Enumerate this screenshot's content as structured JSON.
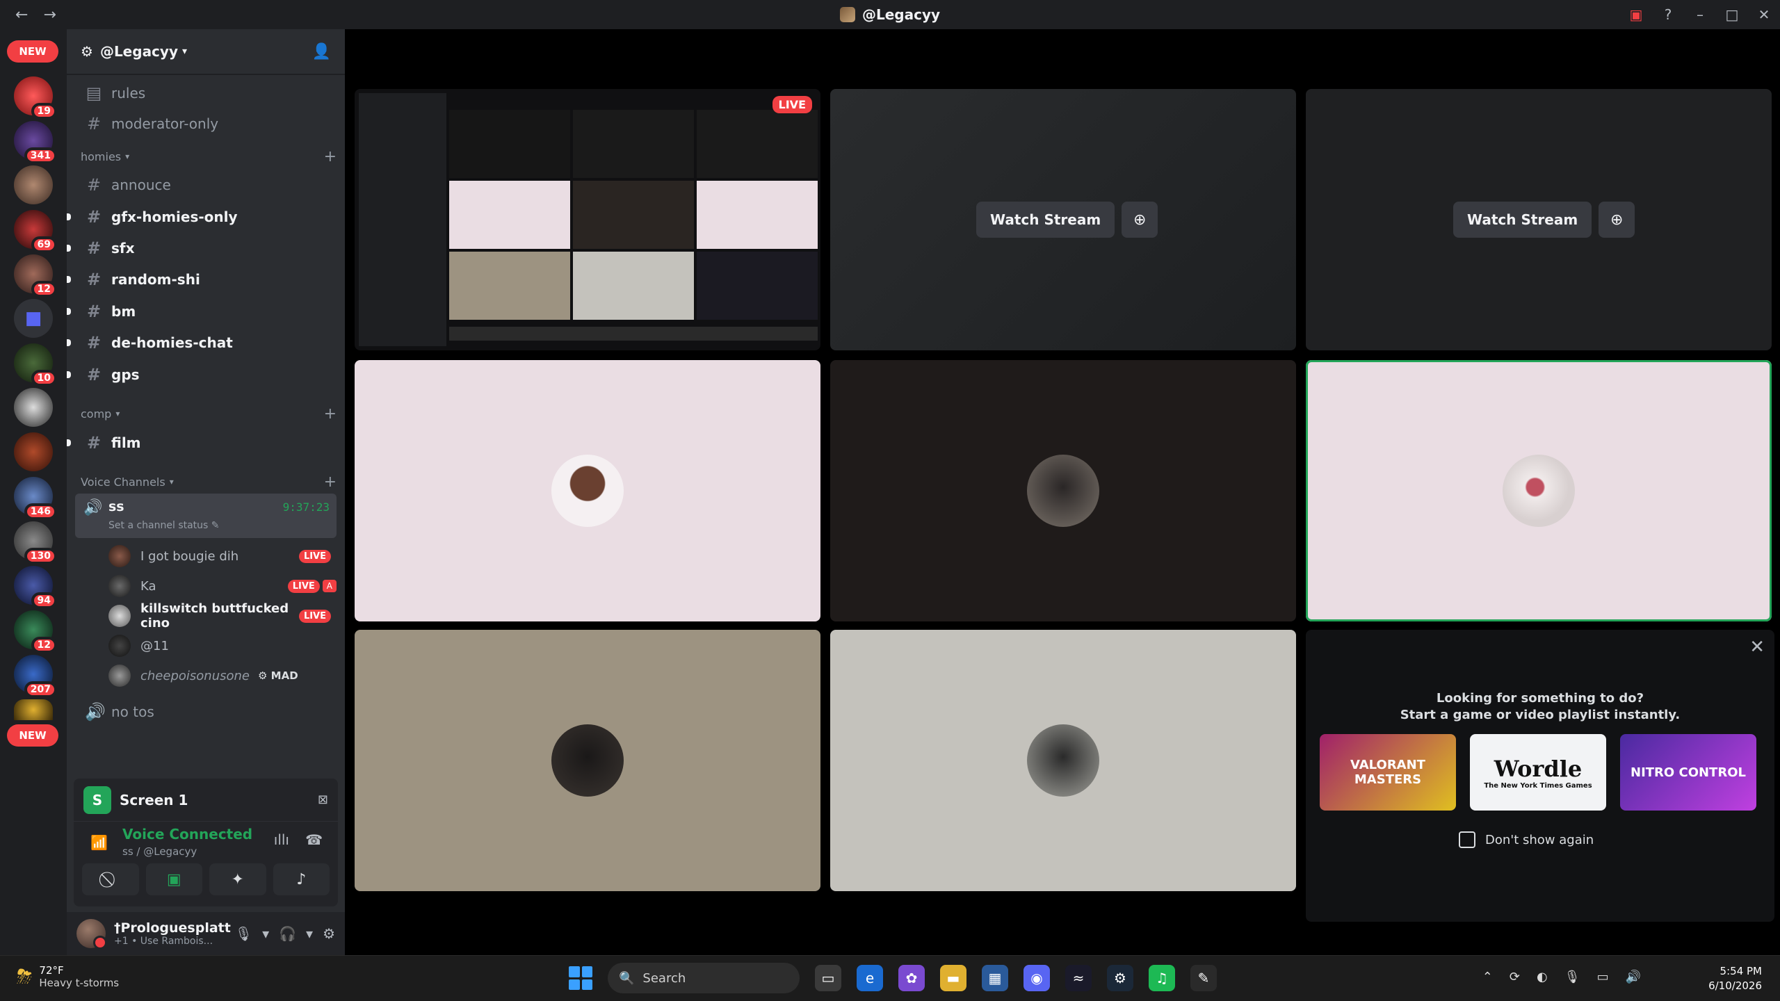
{
  "window": {
    "title": "@Legacyy"
  },
  "rail": {
    "new_top": "NEW",
    "new_bottom": "NEW",
    "badges": [
      "19",
      "341",
      "",
      "69",
      "12",
      "",
      "10",
      "",
      "",
      "146",
      "130",
      "94",
      "12",
      "207"
    ]
  },
  "server": {
    "name": "@Legacyy",
    "channels_top": [
      "rules",
      "moderator-only"
    ],
    "cat_homies": "homies",
    "homies_channels": [
      "annouce",
      "gfx-homies-only",
      "sfx",
      "random-shi",
      "bm",
      "de-homies-chat",
      "gps"
    ],
    "cat_comp": "comp",
    "comp_channels": [
      "film"
    ],
    "cat_voice": "Voice Channels",
    "voice": {
      "name": "ss",
      "status": "Set a channel status",
      "timer": "9:37:23",
      "users": [
        {
          "name": "I got bougie dih",
          "live": "LIVE"
        },
        {
          "name": "Ka",
          "live": "LIVE"
        },
        {
          "name": "killswitch buttfucked cino",
          "live": "LIVE"
        },
        {
          "name": "@11",
          "live": ""
        },
        {
          "name": "cheepoisonusone",
          "live": "",
          "tag": "MAD"
        }
      ],
      "other": "no tos"
    }
  },
  "panel": {
    "screen_title": "Screen 1",
    "vc_title": "Voice Connected",
    "vc_sub": "ss / @Legacyy"
  },
  "user": {
    "name": "†Prologuesplatt",
    "status": "+1 • Use Rambois..."
  },
  "stage": {
    "live": "LIVE",
    "watch_label": "Watch Stream",
    "activity_line1": "Looking for something to do?",
    "activity_line2": "Start a game or video playlist instantly.",
    "cards": [
      "VALORANT MASTERS",
      "Wordle",
      "NITRO CONTROL"
    ],
    "wordle_sub": "The New York Times Games",
    "dont_show": "Don't show again"
  },
  "taskbar": {
    "temp": "72°F",
    "weather": "Heavy t-storms",
    "search": "Search",
    "time": "5:54 PM",
    "date": "6/10/2026"
  },
  "colors": {
    "accent": "#23a559",
    "danger": "#f23f43",
    "sidebar": "#2b2d31"
  }
}
